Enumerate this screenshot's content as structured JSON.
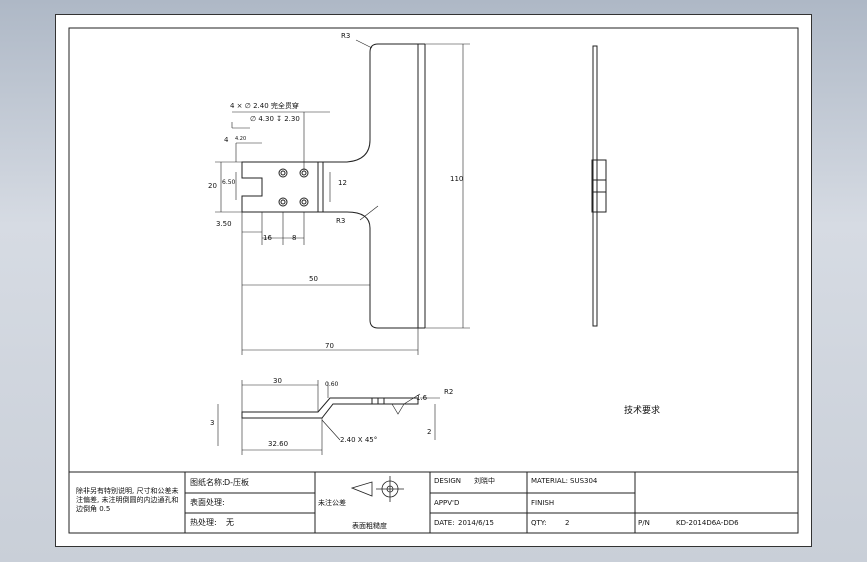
{
  "drawing": {
    "dims": {
      "r3_top": "R3",
      "r3_mid": "R3",
      "hole_callout": "4 × ∅ 2.40 完全贯穿",
      "counterbore": "∅ 4.30 ↧ 2.30",
      "d_4": "4",
      "d_4_small": "4.20",
      "d_20": "20",
      "d_6_50": "6.50",
      "d_12": "12",
      "d_3_50": "3.50",
      "d_16": "16",
      "d_8": "8",
      "d_50": "50",
      "d_70": "70",
      "d_110": "110",
      "d_30": "30",
      "d_0_60": "0.60",
      "d_32_60": "32.60",
      "d_1_6": "1.6",
      "d_r2": "R2",
      "d_2": "2",
      "d_3": "3",
      "chamfer": "2.40 X 45°"
    },
    "tech_requirements": "技术要求"
  },
  "title_block": {
    "note": "除非另有特别说明, 尺寸和公差未注偏差, 未注明倒圆的内边通孔和边倒角 0.5",
    "part_name_label": "图纸名称:",
    "part_name": "D-压板",
    "surface_label": "表面处理:",
    "surface_value": "",
    "heat_label": "热处理:",
    "heat_value": "无",
    "roughness_label": "未注公差",
    "roughness_note": "表面粗糙度",
    "design_label": "DESIGN",
    "designer": "刘晓中",
    "material_label": "MATERIAL:",
    "material": "SUS304",
    "approved_label": "APPV'D",
    "finish_label": "FINISH",
    "date_label": "DATE:",
    "date": "2014/6/15",
    "qty_label": "QTY:",
    "qty": "2",
    "pn_label": "P/N",
    "pn": "KD-2014D6A-DD6"
  }
}
